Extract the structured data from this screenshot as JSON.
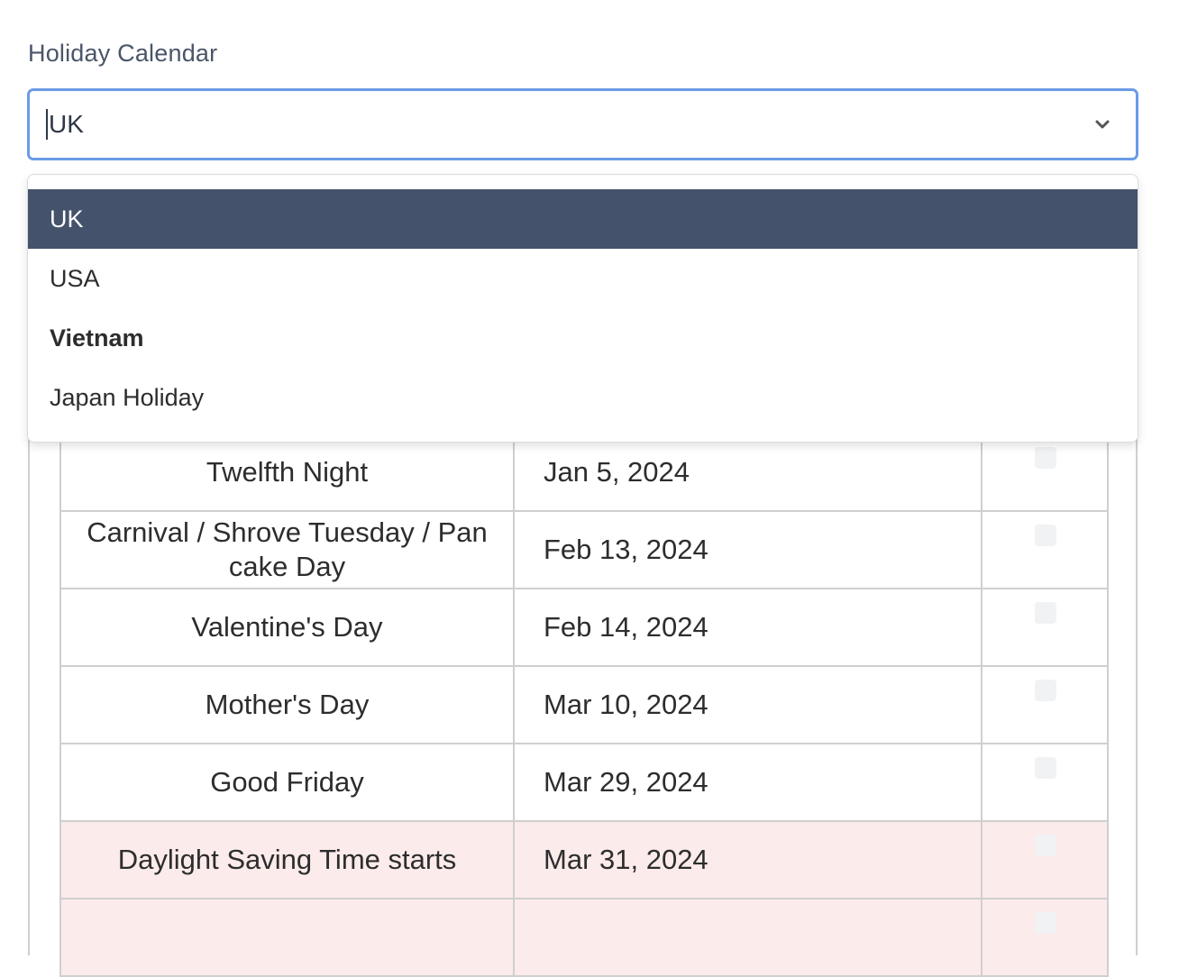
{
  "field": {
    "label": "Holiday Calendar",
    "value": "UK",
    "chevron_icon": "chevron-down-icon"
  },
  "dropdown": {
    "options": [
      {
        "label": "UK",
        "selected": true
      },
      {
        "label": "USA",
        "selected": false
      },
      {
        "label": "Vietnam",
        "selected": false,
        "bold": true
      },
      {
        "label": "Japan Holiday",
        "selected": false
      }
    ]
  },
  "table": {
    "rows": [
      {
        "name": "Twelfth Night",
        "date": "Jan 5, 2024",
        "highlight": false
      },
      {
        "name": "Carnival / Shrove Tuesday / Pan cake Day",
        "date": "Feb 13, 2024",
        "highlight": false
      },
      {
        "name": "Valentine's Day",
        "date": "Feb 14, 2024",
        "highlight": false
      },
      {
        "name": "Mother's Day",
        "date": "Mar 10, 2024",
        "highlight": false
      },
      {
        "name": "Good Friday",
        "date": "Mar 29, 2024",
        "highlight": false
      },
      {
        "name": "Daylight Saving Time starts",
        "date": "Mar 31, 2024",
        "highlight": true
      },
      {
        "name": "",
        "date": "",
        "highlight": true
      }
    ]
  },
  "colors": {
    "focus_border": "#6b9be8",
    "selected_option_bg": "#44526b",
    "highlight_row_bg": "#fcebeb"
  }
}
